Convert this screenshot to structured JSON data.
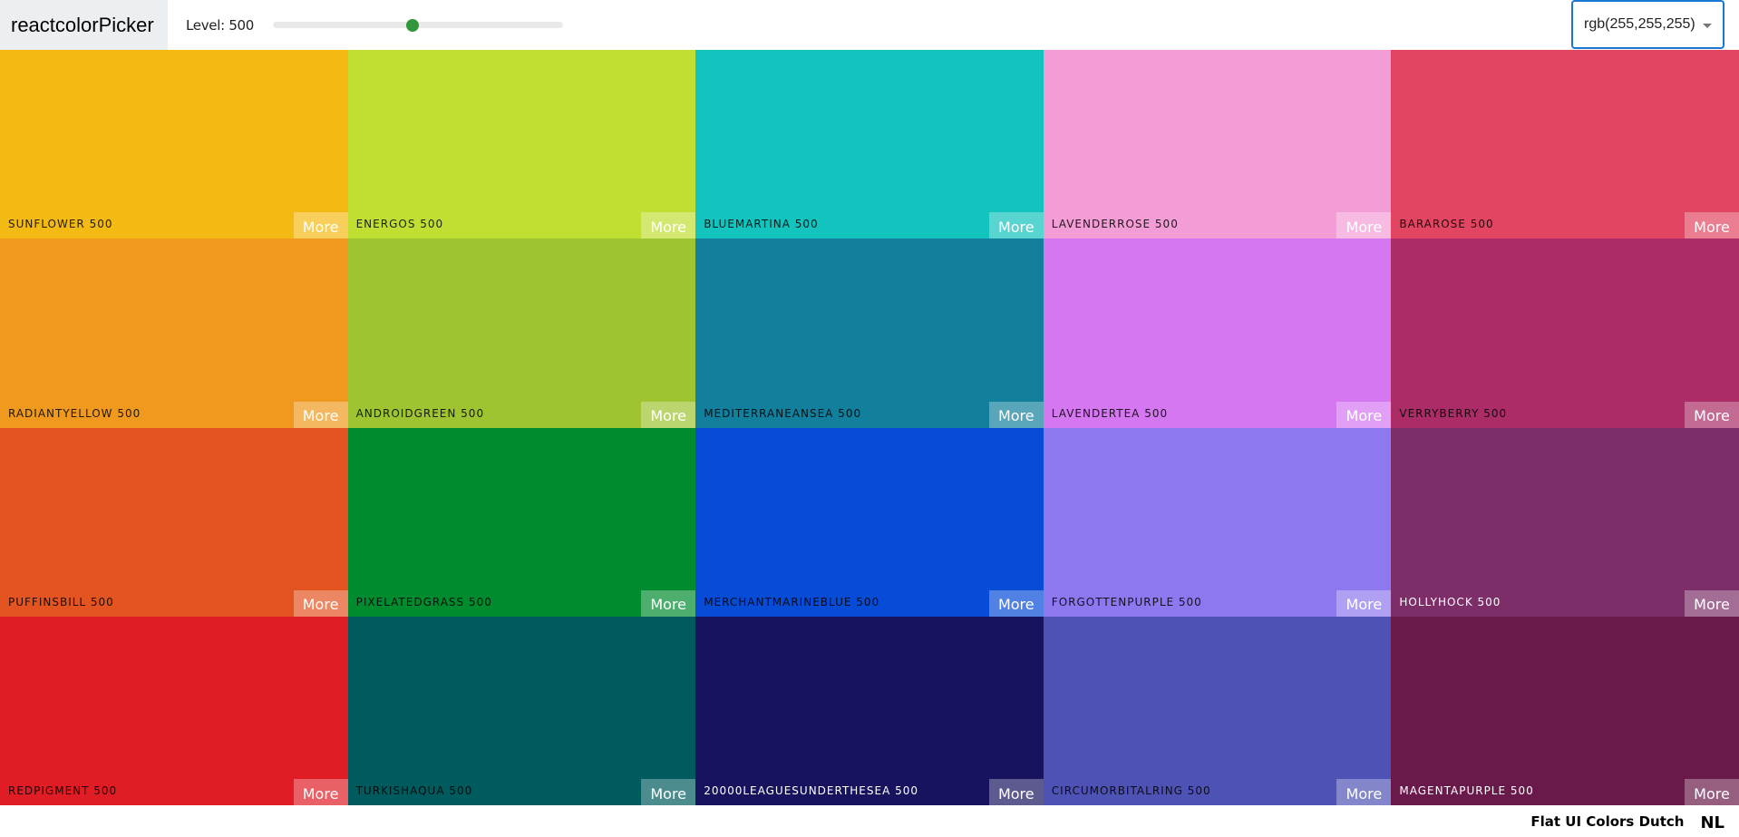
{
  "navbar": {
    "logo": "reactcolorPicker",
    "level_label": "Level: 500",
    "level": {
      "value": 500,
      "min": 100,
      "max": 900
    },
    "format_select": {
      "value": "rgb(255,255,255)"
    },
    "colors": {
      "slider_thumb": "#30983a",
      "select_border": "#1976d2",
      "logo_bg": "#eceff1"
    }
  },
  "palette": {
    "more_label": "More",
    "colors": [
      {
        "name": "SUNFLOWER 500",
        "color": "#f4ba14",
        "light_text": false
      },
      {
        "name": "ENERGOS 500",
        "color": "#bfdf33",
        "light_text": false
      },
      {
        "name": "BLUEMARTINA 500",
        "color": "#12c3be",
        "light_text": false
      },
      {
        "name": "LAVENDERROSE 500",
        "color": "#f39dd7",
        "light_text": false
      },
      {
        "name": "BARAROSE 500",
        "color": "#e24561",
        "light_text": false
      },
      {
        "name": "RADIANTYELLOW 500",
        "color": "#ef9a1f",
        "light_text": false
      },
      {
        "name": "ANDROIDGREEN 500",
        "color": "#9ec432",
        "light_text": false
      },
      {
        "name": "MEDITERRANEANSEA 500",
        "color": "#127f9c",
        "light_text": false
      },
      {
        "name": "LAVENDERTEA 500",
        "color": "#d477f1",
        "light_text": false
      },
      {
        "name": "VERRYBERRY 500",
        "color": "#ab2c66",
        "light_text": false
      },
      {
        "name": "PUFFINSBILL 500",
        "color": "#e35420",
        "light_text": false
      },
      {
        "name": "PIXELATEDGRASS 500",
        "color": "#008c2e",
        "light_text": false
      },
      {
        "name": "MERCHANTMARINEBLUE 500",
        "color": "#064cd7",
        "light_text": false
      },
      {
        "name": "FORGOTTENPURPLE 500",
        "color": "#8f78ef",
        "light_text": false
      },
      {
        "name": "HOLLYHOCK 500",
        "color": "#7d2e69",
        "light_text": true
      },
      {
        "name": "REDPIGMENT 500",
        "color": "#e01d24",
        "light_text": false
      },
      {
        "name": "TURKISHAQUA 500",
        "color": "#005b5e",
        "light_text": false
      },
      {
        "name": "20000LEAGUESUNDERTHESEA 500",
        "color": "#17135f",
        "light_text": true
      },
      {
        "name": "CIRCUMORBITALRING 500",
        "color": "#4e52b4",
        "light_text": false
      },
      {
        "name": "MAGENTAPURPLE 500",
        "color": "#691a4a",
        "light_text": true
      }
    ]
  },
  "footer": {
    "palette_name": "Flat UI Colors Dutch",
    "emoji": "NL"
  }
}
